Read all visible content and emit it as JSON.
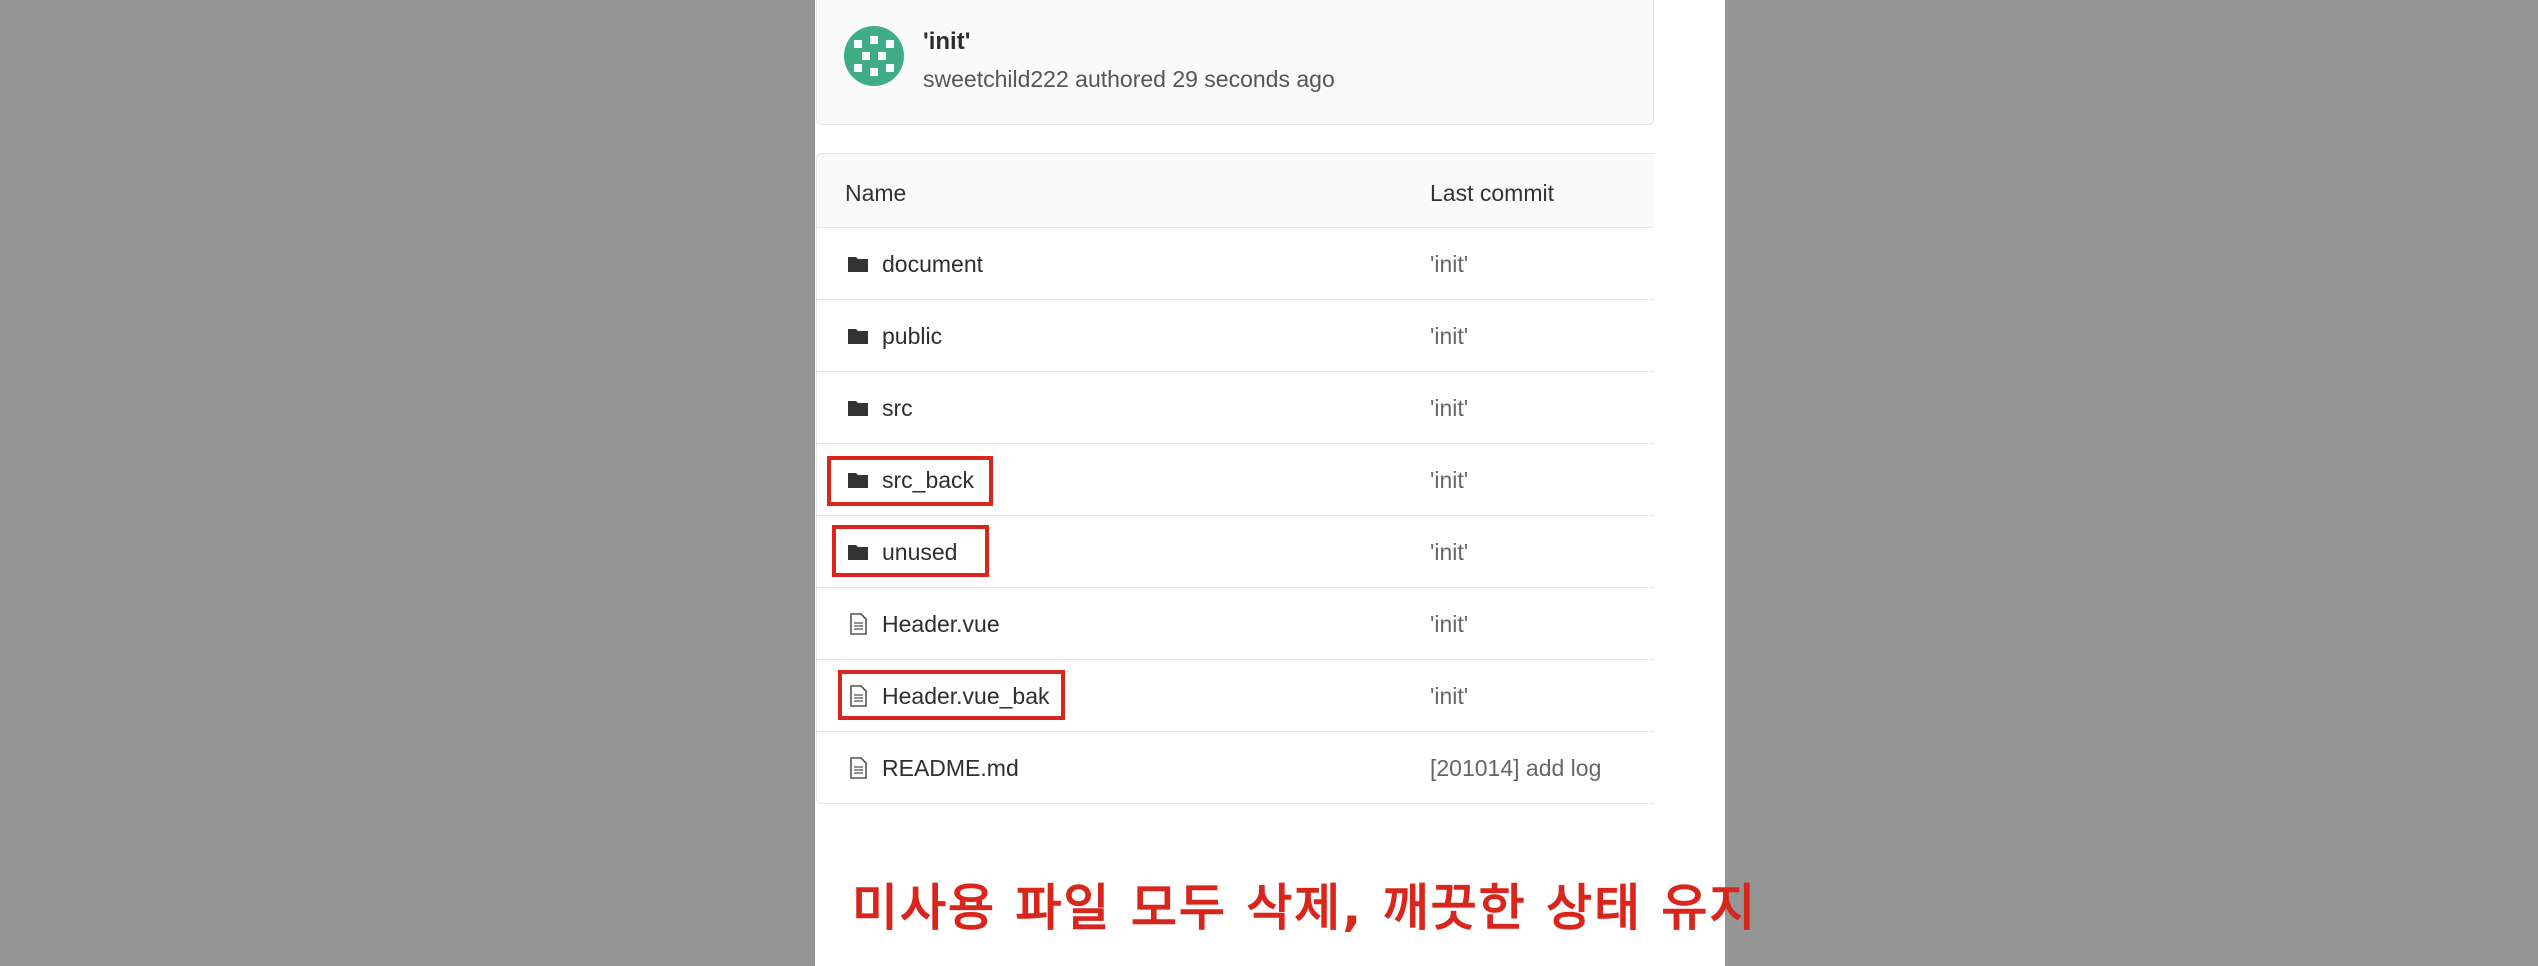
{
  "commit": {
    "title": "'init'",
    "author_line": "sweetchild222 authored 29 seconds ago"
  },
  "table": {
    "headers": {
      "name": "Name",
      "last_commit": "Last commit"
    },
    "rows": [
      {
        "name": "document",
        "type": "folder",
        "commit": "'init'"
      },
      {
        "name": "public",
        "type": "folder",
        "commit": "'init'"
      },
      {
        "name": "src",
        "type": "folder",
        "commit": "'init'"
      },
      {
        "name": "src_back",
        "type": "folder",
        "commit": "'init'"
      },
      {
        "name": "unused",
        "type": "folder",
        "commit": "'init'"
      },
      {
        "name": "Header.vue",
        "type": "file",
        "commit": "'init'"
      },
      {
        "name": "Header.vue_bak",
        "type": "file",
        "commit": "'init'"
      },
      {
        "name": "README.md",
        "type": "file",
        "commit": "[201014] add log"
      }
    ]
  },
  "highlight_color": "#d9261c",
  "caption": "미사용 파일 모두 삭제, 깨끗한 상태 유지"
}
